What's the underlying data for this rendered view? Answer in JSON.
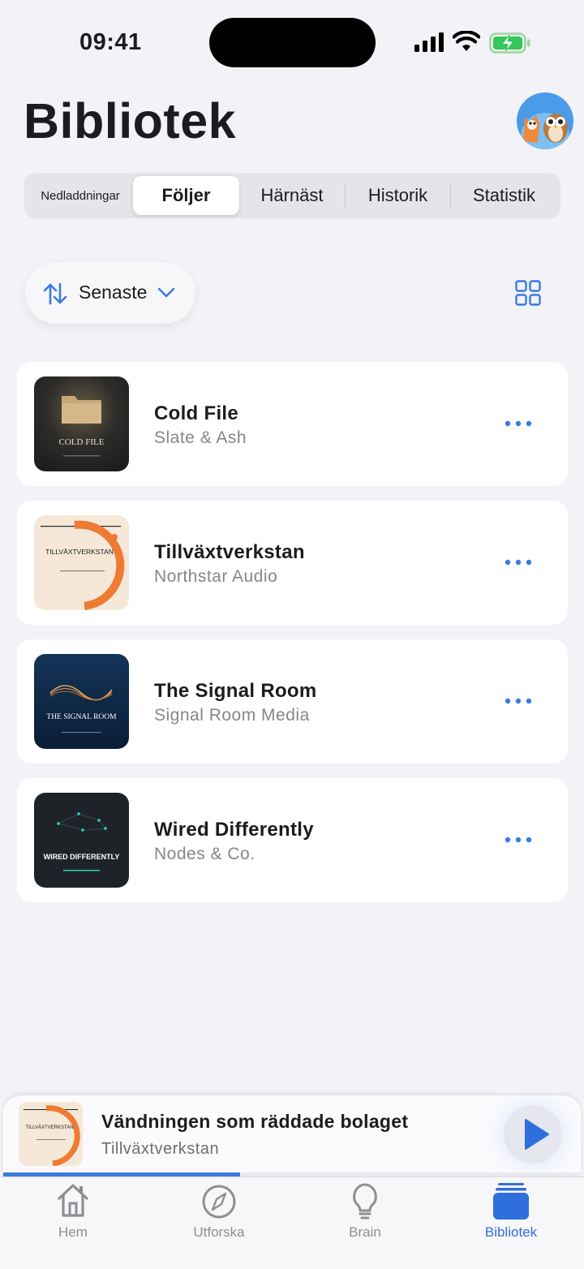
{
  "status_bar": {
    "time": "09:41"
  },
  "header": {
    "title": "Bibliotek"
  },
  "segments": [
    {
      "label": "Nedladdningar",
      "active": false
    },
    {
      "label": "Följer",
      "active": true
    },
    {
      "label": "Härnäst",
      "active": false
    },
    {
      "label": "Historik",
      "active": false
    },
    {
      "label": "Statistik",
      "active": false
    }
  ],
  "sort": {
    "label": "Senaste"
  },
  "podcasts": [
    {
      "title": "Cold File",
      "publisher": "Slate & Ash",
      "art_text": "COLD FILE"
    },
    {
      "title": "Tillväxtverkstan",
      "publisher": "Northstar Audio",
      "art_text": "TILLVÄXTVERKSTAN"
    },
    {
      "title": "The Signal Room",
      "publisher": "Signal Room Media",
      "art_text": "THE SIGNAL ROOM"
    },
    {
      "title": "Wired Differently",
      "publisher": "Nodes & Co.",
      "art_text": "WIRED DIFFERENTLY"
    }
  ],
  "now_playing": {
    "title": "Vändningen som räddade bolaget",
    "show": "Tillväxtverkstan",
    "art_text": "TILLVÄXTVERKSTAN",
    "progress": 0.41
  },
  "tabs": [
    {
      "label": "Hem",
      "icon": "home-icon",
      "active": false
    },
    {
      "label": "Utforska",
      "icon": "compass-icon",
      "active": false
    },
    {
      "label": "Brain",
      "icon": "lightbulb-icon",
      "active": false
    },
    {
      "label": "Bibliotek",
      "icon": "library-icon",
      "active": true
    }
  ],
  "colors": {
    "accent": "#2f6fdc",
    "background": "#f2f2f7",
    "card": "#ffffff",
    "secondary_text": "#86868b"
  }
}
